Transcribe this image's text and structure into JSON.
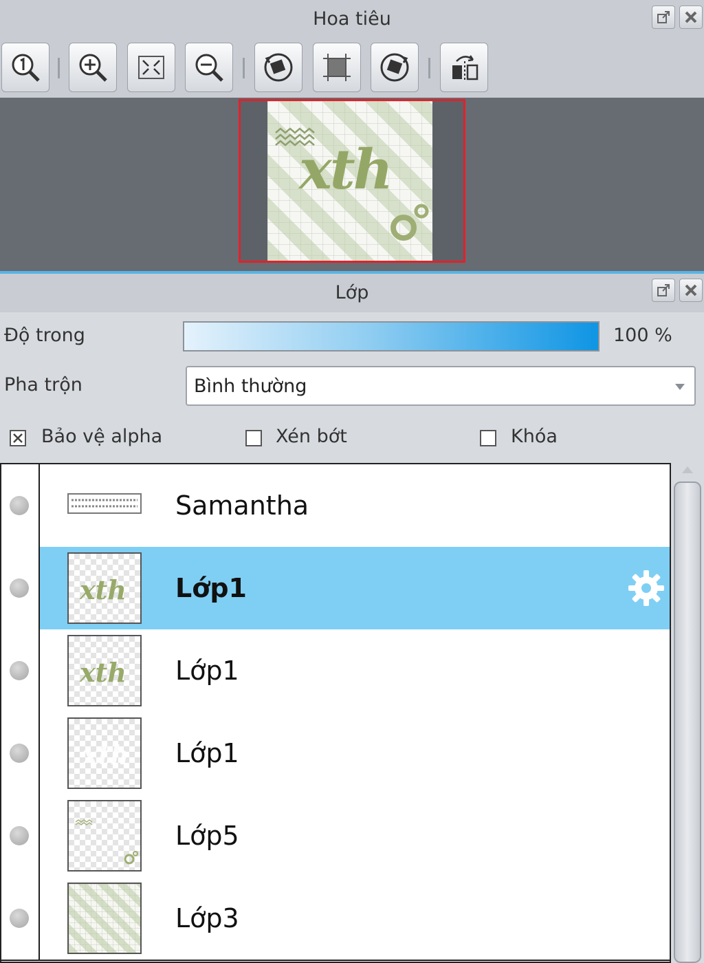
{
  "navigator": {
    "title": "Hoa tiêu",
    "toolbar": [
      {
        "icon": "zoom-actual-size-icon"
      },
      {
        "icon": "zoom-in-icon"
      },
      {
        "icon": "fit-to-window-icon"
      },
      {
        "icon": "zoom-out-icon"
      },
      {
        "icon": "rotate-left-icon"
      },
      {
        "icon": "reset-view-icon"
      },
      {
        "icon": "rotate-right-icon"
      },
      {
        "icon": "flip-horizontal-icon"
      }
    ],
    "preview_text": "xth"
  },
  "layers": {
    "title": "Lớp",
    "opacity": {
      "label": "Độ trong",
      "value": 100,
      "value_text": "100 %"
    },
    "blend": {
      "label": "Pha trộn",
      "value": "Bình thường"
    },
    "checkboxes": [
      {
        "label": "Bảo vệ alpha",
        "checked": true
      },
      {
        "label": "Xén bớt",
        "checked": false
      },
      {
        "label": "Khóa",
        "checked": false
      }
    ],
    "items": [
      {
        "name": "Samantha",
        "selected": false,
        "thumb": "text"
      },
      {
        "name": "Lớp1",
        "selected": true,
        "thumb": "xth"
      },
      {
        "name": "Lớp1",
        "selected": false,
        "thumb": "xth"
      },
      {
        "name": "Lớp1",
        "selected": false,
        "thumb": "white"
      },
      {
        "name": "Lớp5",
        "selected": false,
        "thumb": "shapes"
      },
      {
        "name": "Lớp3",
        "selected": false,
        "thumb": "stripes"
      }
    ]
  },
  "colors": {
    "accent": "#58b4e4",
    "selection": "#7fcff4",
    "preview_border": "#e0222a"
  }
}
